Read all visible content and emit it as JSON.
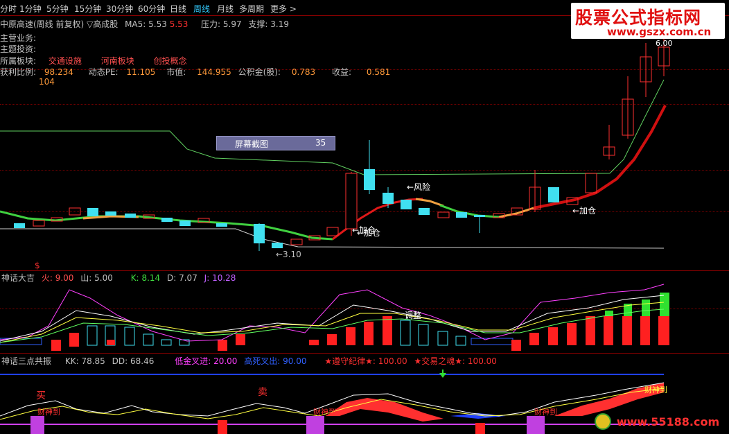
{
  "tabs": [
    "分时",
    "1分钟",
    "5分钟",
    "15分钟",
    "30分钟",
    "60分钟",
    "日线",
    "周线",
    "月线",
    "多周期",
    "更多 >"
  ],
  "active_tab": "周线",
  "watermark": {
    "title": "股票公式指标网",
    "url": "www.gszx.com.cn"
  },
  "header": {
    "stock_title": "中原高速(周线 前复权) ▽高成股",
    "ma5_label": "MA5:",
    "ma5_value": "5.53",
    "ma5_value2": "5.53",
    "pressure_label": "压力:",
    "pressure_value": "5.97",
    "support_label": "支撑:",
    "support_value": "3.19"
  },
  "info": {
    "main_business_label": "主营业务:",
    "theme_label": "主题投资:",
    "sector_label": "所属板块:",
    "sectors": [
      "交通设施",
      "河南板块",
      "创投概念"
    ],
    "profit_ratio_label": "获利比例:",
    "profit_ratio_value": "98.234",
    "pe_label": "动态PE:",
    "pe_value": "11.105",
    "mktcap_label": "市值:",
    "mktcap_value": "144.955",
    "reserve_label": "公积金(股):",
    "reserve_value": "0.783",
    "eps_label": "收益:",
    "eps_value": "0.581",
    "extra_value": "104"
  },
  "screenshot_box": {
    "label": "屏幕截图",
    "value": "35"
  },
  "annotations": {
    "risk": "←风险",
    "add1": "←加仓",
    "add_overlap": "←加仓",
    "add2": "←加仓",
    "low": "←3.10",
    "high": "6.00",
    "dollar": "$"
  },
  "panel2": {
    "title": "神话大吉",
    "huo_label": "火:",
    "huo_value": "9.00",
    "shan_label": "山:",
    "shan_value": "5.00",
    "k_label": "K:",
    "k_value": "8.14",
    "d_label": "D:",
    "d_value": "7.07",
    "j_label": "J:",
    "j_value": "10.28",
    "tiaozheng": "调整"
  },
  "panel3": {
    "title": "神话三点共振",
    "kk_label": "KK:",
    "kk_value": "78.85",
    "dd_label": "DD:",
    "dd_value": "68.46",
    "low_label": "低金叉进:",
    "low_value": "20.00",
    "high_label": "高死叉出:",
    "high_value": "90.00",
    "rule_label": "★遵守纪律★:",
    "rule_value": "100.00",
    "soul_label": "★交易之魂★:",
    "soul_value": "100.00",
    "buy": "买",
    "sell": "卖",
    "caishen": "财神到",
    "bottom_wm": "www.55188.com"
  },
  "colors": {
    "up_candle": "#ff3030",
    "down_candle": "#40e0f0",
    "ma_green": "#40d040",
    "ma_red": "#e01818",
    "ma_orange": "#f0a040",
    "kdj_k": "#ffffff",
    "kdj_d": "#ffff40",
    "kdj_j": "#ff40ff"
  }
}
